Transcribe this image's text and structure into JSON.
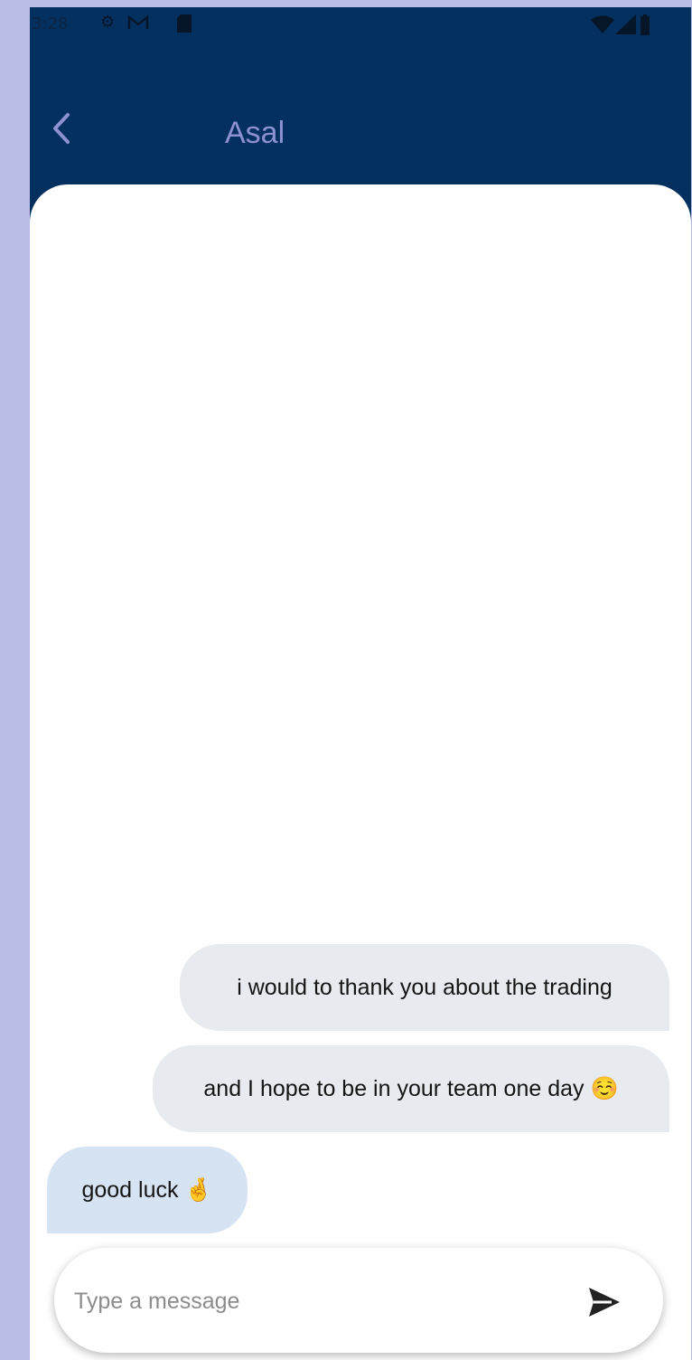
{
  "status_bar": {
    "time": "3:28",
    "icons": [
      "settings-icon",
      "gmail-icon",
      "sd-card-icon",
      "wifi-icon",
      "signal-icon",
      "battery-icon"
    ],
    "colors": {
      "icon": "#071529"
    }
  },
  "top_bar": {
    "back_icon": "chevron-left-icon",
    "title": "Asal",
    "colors": {
      "background": "#03305f",
      "title": "#8d90d1"
    }
  },
  "messages": [
    {
      "direction": "sent",
      "text": "i would to thank you about the trading"
    },
    {
      "direction": "sent",
      "text": "and I hope to be in your team one day ☺️"
    },
    {
      "direction": "received",
      "text": "good luck 🤞"
    }
  ],
  "composer": {
    "placeholder": "Type a message",
    "send_icon": "send-icon"
  },
  "colors": {
    "frame": "#b9bde6",
    "sent_bubble": "#e7eaef",
    "received_bubble": "#d6e3f3",
    "sheet": "#ffffff"
  }
}
